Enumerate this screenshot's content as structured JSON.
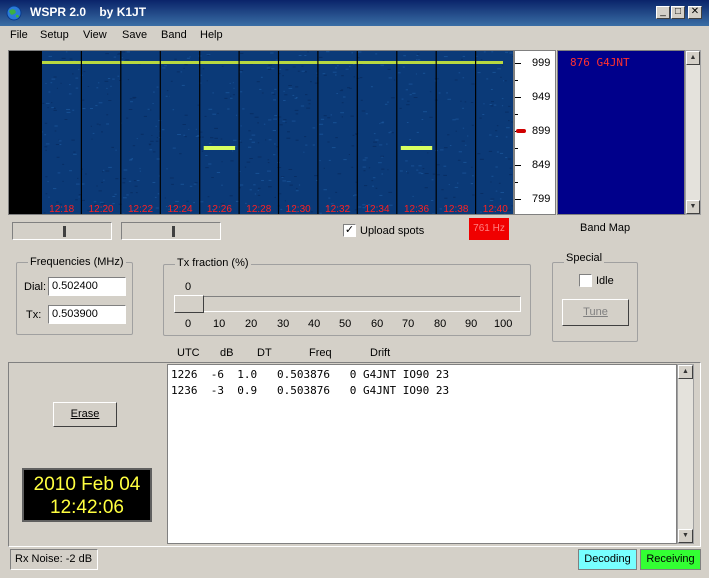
{
  "window": {
    "title": "WSPR 2.0    by K1JT"
  },
  "menu": [
    "File",
    "Setup",
    "View",
    "Save",
    "Band",
    "Help"
  ],
  "waterfall": {
    "time_labels": [
      "12:18",
      "12:20",
      "12:22",
      "12:24",
      "12:26",
      "12:28",
      "12:30",
      "12:32",
      "12:34",
      "12:36",
      "12:38",
      "12:40"
    ],
    "scale_labels": [
      "999",
      "949",
      "899",
      "849",
      "799"
    ],
    "marker_value": 899,
    "colors": {
      "background": "#0b3a78",
      "carrier_line": "#b8d840",
      "signal": "#d8ff60",
      "time_label": "#ff2020"
    }
  },
  "band_map": {
    "entries": [
      "876 G4JNT"
    ],
    "label": "Band Map"
  },
  "upload_spots": {
    "label": "Upload spots",
    "checked": true,
    "mark": "✓"
  },
  "freq_indicator": {
    "text": "761 Hz"
  },
  "frequencies": {
    "group_title": "Frequencies (MHz)",
    "dial_label": "Dial:",
    "dial_value": "0.502400",
    "tx_label": "Tx:",
    "tx_value": "0.503900"
  },
  "tx_fraction": {
    "group_title": "Tx fraction (%)",
    "current_value": "0",
    "ticks": [
      "0",
      "10",
      "20",
      "30",
      "40",
      "50",
      "60",
      "70",
      "80",
      "90",
      "100"
    ]
  },
  "special": {
    "group_title": "Special",
    "idle_label": "Idle",
    "idle_checked": false,
    "tune_label": "Tune"
  },
  "decode_table": {
    "headers": [
      "UTC",
      "dB",
      "DT",
      "Freq",
      "Drift"
    ],
    "rows": [
      "1226  -6  1.0   0.503876   0 G4JNT IO90 23",
      "1236  -3  0.9   0.503876   0 G4JNT IO90 23"
    ]
  },
  "erase_button": "Erase",
  "clock": {
    "date": "2010 Feb 04",
    "time": "12:42:06"
  },
  "status": {
    "rx_noise": "Rx Noise: -2 dB",
    "decoding": "Decoding",
    "receiving": "Receiving"
  }
}
